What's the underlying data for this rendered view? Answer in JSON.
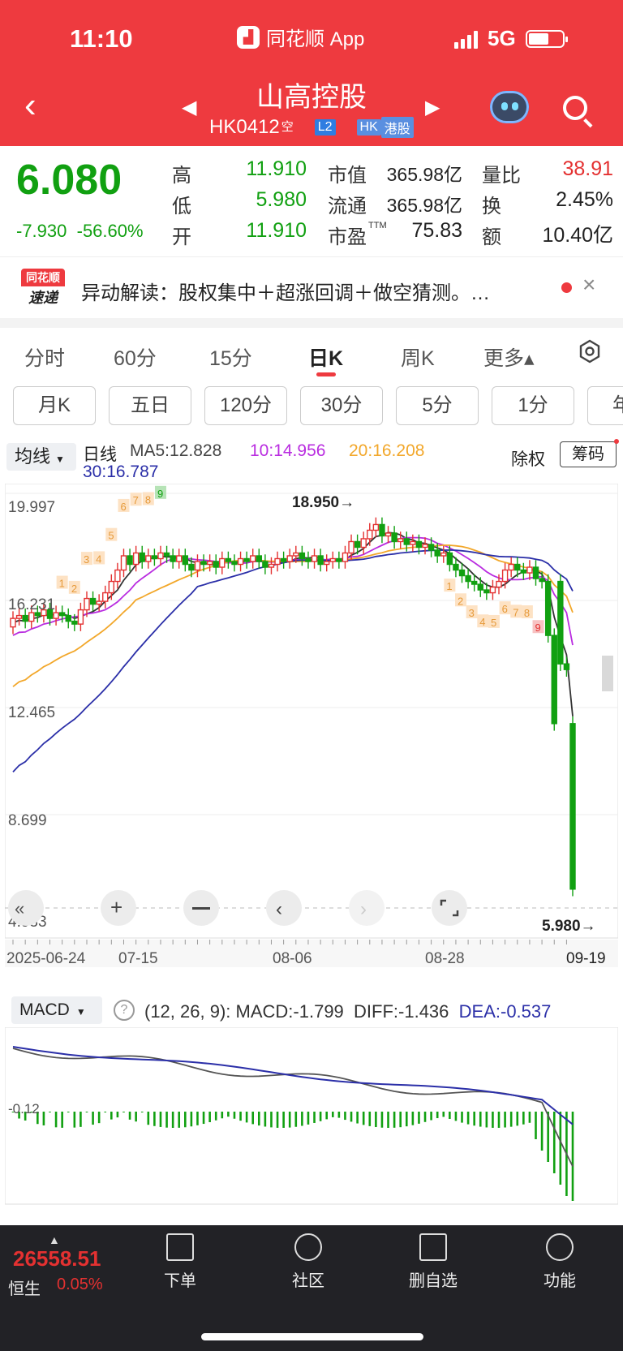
{
  "status": {
    "time": "11:10",
    "app": "同花顺 App",
    "network": "5G"
  },
  "header": {
    "back_icon": "chevron-left-icon",
    "title": "山高控股",
    "code": "HK0412",
    "short_mark": "空",
    "badge_l2": "L2",
    "badge_hk": "HK",
    "badge_hs": "港股"
  },
  "quote": {
    "price": "6.080",
    "change": "-7.930",
    "change_pct": "-56.60%",
    "high_label": "高",
    "high": "11.910",
    "low_label": "低",
    "low": "5.980",
    "open_label": "开",
    "open": "11.910",
    "mktcap_label": "市值",
    "mktcap": "365.98亿",
    "float_label": "流通",
    "float": "365.98亿",
    "pe_label": "市盈",
    "pe_sup": "TTM",
    "pe": "75.83",
    "volratio_label": "量比",
    "volratio": "38.91",
    "turnover_label": "换",
    "turnover": "2.45%",
    "amount_label": "额",
    "amount": "10.40亿"
  },
  "news": {
    "logo_top": "同花顺",
    "logo_bottom": "速递",
    "text": "异动解读：股权集中＋超涨回调＋做空猜测。…"
  },
  "tabs": [
    "分时",
    "60分",
    "15分",
    "日K",
    "周K",
    "更多▴"
  ],
  "active_tab": "日K",
  "pills": [
    "月K",
    "五日",
    "120分",
    "30分",
    "5分",
    "1分",
    "年"
  ],
  "indicator": {
    "select": "均线",
    "line_type": "日线",
    "ma5": "MA5:12.828",
    "ma10": "10:14.956",
    "ma20": "20:16.208",
    "ma30": "30:16.787",
    "chuquan": "除权",
    "chouma": "筹码"
  },
  "chart_labels": {
    "y_ticks": [
      "19.997",
      "16.231",
      "12.465",
      "8.699",
      "4.933"
    ],
    "x_ticks": [
      "2025-06-24",
      "07-15",
      "08-06",
      "08-28",
      "09-19"
    ],
    "max_label": "18.950→",
    "min_label": "5.980→",
    "td_up": [
      "1",
      "2",
      "3",
      "4",
      "5",
      "6",
      "7",
      "8",
      "9"
    ],
    "td_down": [
      "1",
      "2",
      "3",
      "4",
      "5",
      "6",
      "7",
      "8",
      "9"
    ]
  },
  "chart_data": {
    "type": "candlestick",
    "ylim": [
      4.933,
      19.997
    ],
    "x": [
      "2025-06-24",
      "07-15",
      "08-06",
      "08-28",
      "09-19"
    ],
    "closes": [
      15.6,
      15.7,
      15.5,
      15.8,
      15.7,
      15.9,
      15.6,
      15.8,
      15.7,
      15.5,
      15.4,
      15.9,
      16.3,
      16.1,
      16.2,
      16.5,
      16.9,
      17.3,
      17.8,
      17.5,
      17.9,
      17.6,
      17.8,
      17.7,
      17.9,
      17.8,
      17.6,
      17.8,
      17.5,
      17.3,
      17.6,
      17.5,
      17.6,
      17.4,
      17.7,
      17.6,
      17.5,
      17.7,
      17.6,
      17.8,
      17.6,
      17.4,
      17.5,
      17.7,
      17.6,
      17.8,
      17.9,
      17.7,
      17.6,
      17.8,
      17.5,
      17.6,
      17.7,
      17.6,
      17.9,
      18.3,
      18.1,
      18.4,
      18.7,
      18.9,
      18.5,
      18.6,
      18.3,
      18.4,
      18.2,
      18.3,
      18.1,
      18.2,
      18.0,
      17.8,
      17.9,
      17.5,
      17.3,
      17.1,
      16.9,
      16.8,
      16.6,
      16.5,
      16.7,
      16.9,
      17.3,
      17.5,
      17.3,
      17.2,
      17.4,
      17.0,
      16.9,
      15.0,
      11.9,
      14.0,
      13.8,
      6.08
    ],
    "ma_series": [
      {
        "name": "MA5",
        "value": 12.828
      },
      {
        "name": "MA10",
        "value": 14.956
      },
      {
        "name": "MA20",
        "value": 16.208
      },
      {
        "name": "MA30",
        "value": 16.787
      }
    ],
    "high": 18.95,
    "low": 5.98
  },
  "macd": {
    "select": "MACD",
    "params": "(12, 26, 9):",
    "macd": "MACD:-1.799",
    "diff": "DIFF:-1.436",
    "dea": "DEA:-0.537",
    "zero_label": "-0.12"
  },
  "bottom": {
    "index_value": "26558.51",
    "index_name": "恒生",
    "index_pct": "0.05%",
    "nav": [
      "下单",
      "社区",
      "删自选",
      "功能"
    ]
  },
  "colors": {
    "up": "#e43131",
    "down": "#11a011",
    "ma5": "#333333",
    "ma10": "#b92ce0",
    "ma20": "#f2a72a",
    "ma30": "#2b2fa8",
    "header": "#ee3a3f"
  }
}
